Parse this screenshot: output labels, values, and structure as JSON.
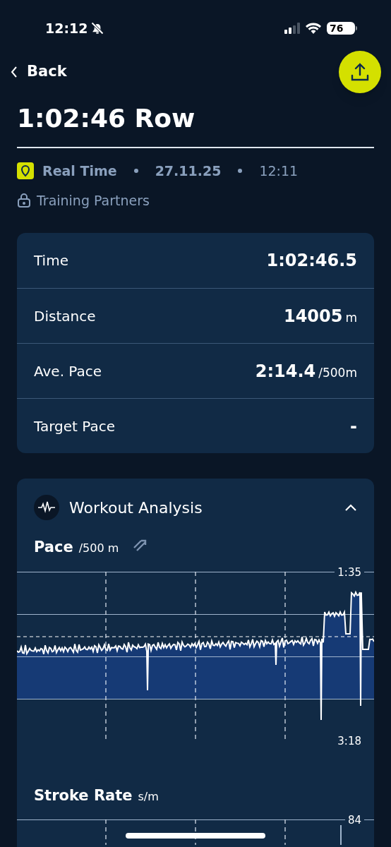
{
  "status_bar": {
    "time": "12:12",
    "battery": "76"
  },
  "nav": {
    "back": "Back"
  },
  "title": "1:02:46 Row",
  "meta": {
    "mode": "Real Time",
    "date": "27.11.25",
    "time": "12:11"
  },
  "privacy": "Training Partners",
  "stats": [
    {
      "label": "Time",
      "value": "1:02:46.5"
    },
    {
      "label": "Distance",
      "value": "14005",
      "unit": "m"
    },
    {
      "label": "Ave. Pace",
      "value": "2:14.4",
      "unit": "/500m"
    },
    {
      "label": "Target Pace",
      "value": "-"
    }
  ],
  "analysis": {
    "title": "Workout Analysis",
    "expanded": true,
    "charts": [
      {
        "title": "Pace",
        "unit": "/500 m",
        "top_tick": "1:35",
        "bottom_tick": "3:18"
      },
      {
        "title": "Stroke Rate",
        "unit": "s/m",
        "top_tick": "84"
      }
    ]
  }
}
